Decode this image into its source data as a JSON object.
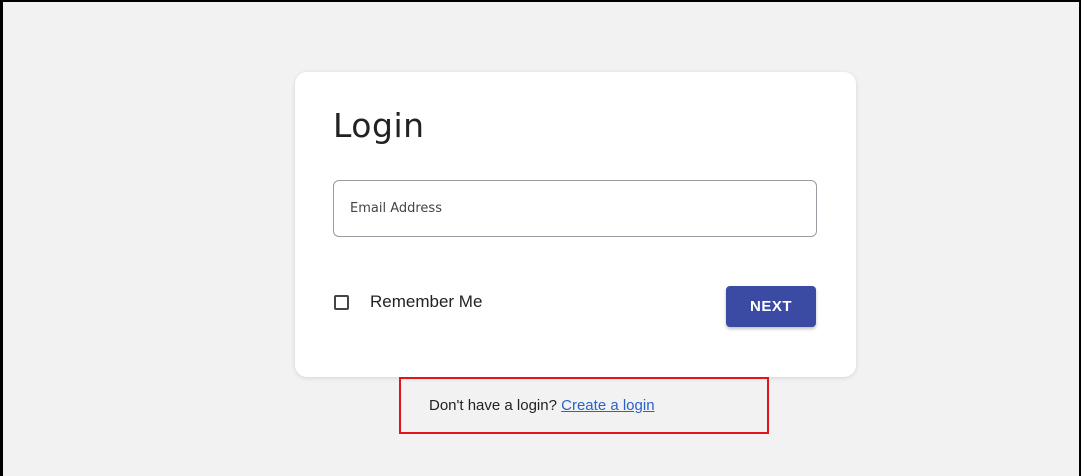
{
  "login_card": {
    "title": "Login",
    "email": {
      "placeholder": "Email Address",
      "value": ""
    },
    "remember_me": {
      "label": "Remember Me",
      "checked": false
    },
    "next_label": "NEXT"
  },
  "signup": {
    "prompt": "Don't have a login?",
    "link_label": "Create a login"
  },
  "colors": {
    "page_background": "#f2f2f2",
    "card_background": "#ffffff",
    "primary_button": "#3b4aa3",
    "link": "#2a62c9",
    "highlight_box": "#e4131b"
  }
}
